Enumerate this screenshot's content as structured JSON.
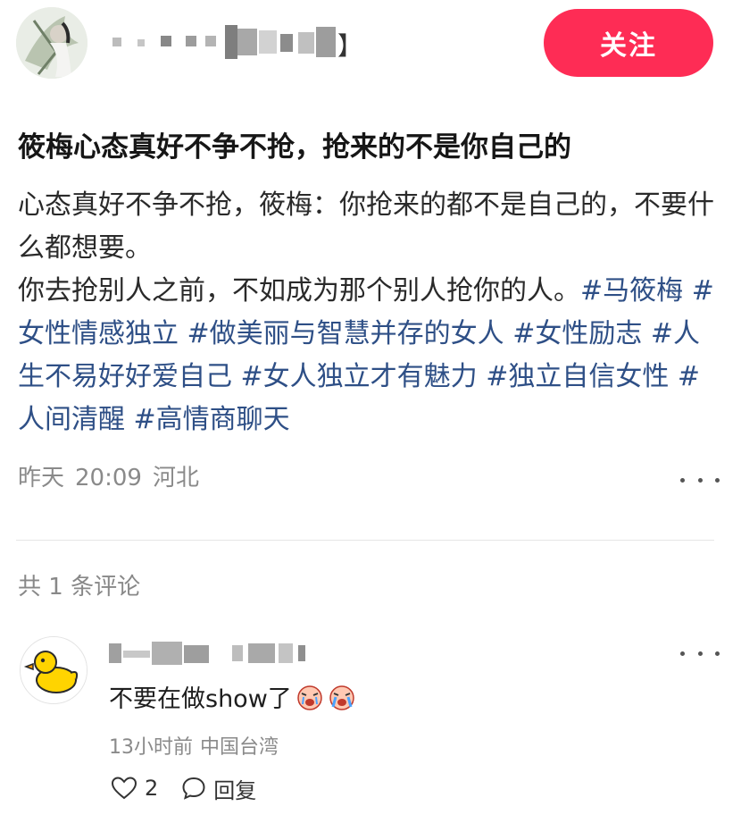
{
  "header": {
    "follow_label": "关注",
    "username_visible_fragment": "】"
  },
  "post": {
    "title": "筱梅心态真好不争不抢，抢来的不是你自己的",
    "body_line1": "心态真好不争不抢，筱梅：你抢来的都不是自己的，不要什么都想要。",
    "body_line2": "你去抢别人之前，不如成为那个别人抢你的人。",
    "hashtags": [
      "#马筱梅",
      "#女性情感独立",
      "#做美丽与智慧并存的女人",
      "#女性励志",
      "#人生不易好好爱自己",
      "#女人独立才有魅力",
      "#独立自信女性",
      "#人间清醒",
      "#高情商聊天"
    ],
    "date": "昨天",
    "time": "20:09",
    "location": "河北"
  },
  "comments_section": {
    "count_label": "共 1 条评论"
  },
  "comment": {
    "text": "不要在做show了",
    "time_ago": "13小时前",
    "location": "中国台湾",
    "likes": "2",
    "reply_label": "回复"
  },
  "colors": {
    "accent": "#fe2c55",
    "hashtag": "#2e4f86",
    "meta_text": "#8a8a8a"
  },
  "icons": {
    "post_more": "more-horizontal-icon",
    "comment_more": "more-horizontal-icon",
    "like": "heart-outline-icon",
    "reply": "speech-bubble-icon",
    "comment_avatar": "yellow-duck-icon",
    "emoji": "crying-face-emoji"
  }
}
